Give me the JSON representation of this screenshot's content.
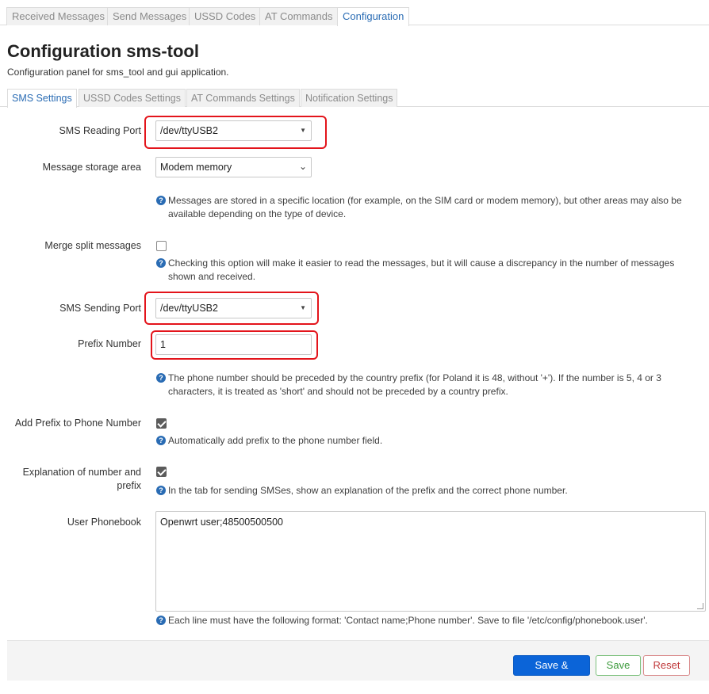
{
  "top_tabs": [
    {
      "label": "Received Messages",
      "active": false
    },
    {
      "label": "Send Messages",
      "active": false
    },
    {
      "label": "USSD Codes",
      "active": false
    },
    {
      "label": "AT Commands",
      "active": false
    },
    {
      "label": "Configuration",
      "active": true
    }
  ],
  "page": {
    "title": "Configuration sms-tool",
    "description": "Configuration panel for sms_tool and gui application."
  },
  "sub_tabs": [
    {
      "label": "SMS Settings",
      "active": true
    },
    {
      "label": "USSD Codes Settings",
      "active": false
    },
    {
      "label": "AT Commands Settings",
      "active": false
    },
    {
      "label": "Notification Settings",
      "active": false
    }
  ],
  "form": {
    "reading_port": {
      "label": "SMS Reading Port",
      "value": "/dev/ttyUSB2"
    },
    "storage": {
      "label": "Message storage area",
      "value": "Modem memory",
      "hint": "Messages are stored in a specific location (for example, on the SIM card or modem memory), but other areas may also be available depending on the type of device."
    },
    "merge": {
      "label": "Merge split messages",
      "checked": false,
      "hint": "Checking this option will make it easier to read the messages, but it will cause a discrepancy in the number of messages shown and received."
    },
    "sending_port": {
      "label": "SMS Sending Port",
      "value": "/dev/ttyUSB2"
    },
    "prefix": {
      "label": "Prefix Number",
      "value": "1",
      "hint": "The phone number should be preceded by the country prefix (for Poland it is 48, without '+'). If the number is 5, 4 or 3 characters, it is treated as 'short' and should not be preceded by a country prefix."
    },
    "add_prefix": {
      "label": "Add Prefix to Phone Number",
      "checked": true,
      "hint": "Automatically add prefix to the phone number field."
    },
    "explanation": {
      "label_line1": "Explanation of number and",
      "label_line2": "prefix",
      "checked": true,
      "hint": "In the tab for sending SMSes, show an explanation of the prefix and the correct phone number."
    },
    "phonebook": {
      "label": "User Phonebook",
      "value": "Openwrt user;48500500500",
      "hint": "Each line must have the following format: 'Contact name;Phone number'. Save to file '/etc/config/phonebook.user'."
    }
  },
  "actions": {
    "save_apply": "Save & Apply",
    "save": "Save",
    "reset": "Reset"
  },
  "colors": {
    "accent": "#2a6cb4",
    "highlight": "#e3141b",
    "primary_button": "#0b64d8",
    "save_button": "#3c9a3c",
    "reset_button": "#c0393b"
  },
  "icons": {
    "help": "question-circle-icon",
    "dropdown": "caret-down-icon"
  }
}
